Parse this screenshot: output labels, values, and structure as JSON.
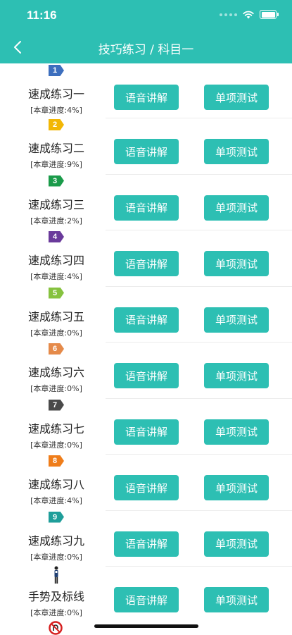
{
  "status_bar": {
    "time": "11:16"
  },
  "nav": {
    "title": "技巧练习 / 科目一",
    "back_icon": "chevron-left-icon"
  },
  "colors": {
    "accent": "#2dbfb3"
  },
  "buttons": {
    "voice": "语音讲解",
    "test": "单项测试"
  },
  "rows": [
    {
      "badge": "1",
      "badge_color": "#3d6fbe",
      "title": "速成练习一",
      "progress": "[本章进度:4%]"
    },
    {
      "badge": "2",
      "badge_color": "#f2b705",
      "title": "速成练习二",
      "progress": "[本章进度:9%]"
    },
    {
      "badge": "3",
      "badge_color": "#1a9b4a",
      "title": "速成练习三",
      "progress": "[本章进度:2%]"
    },
    {
      "badge": "4",
      "badge_color": "#6a3a9b",
      "title": "速成练习四",
      "progress": "[本章进度:4%]"
    },
    {
      "badge": "5",
      "badge_color": "#86c23f",
      "title": "速成练习五",
      "progress": "[本章进度:0%]"
    },
    {
      "badge": "6",
      "badge_color": "#e58a4a",
      "title": "速成练习六",
      "progress": "[本章进度:0%]"
    },
    {
      "badge": "7",
      "badge_color": "#4a4a4a",
      "title": "速成练习七",
      "progress": "[本章进度:0%]"
    },
    {
      "badge": "8",
      "badge_color": "#ef7d1a",
      "title": "速成练习八",
      "progress": "[本章进度:4%]"
    },
    {
      "badge": "9",
      "badge_color": "#1f9e9a",
      "title": "速成练习九",
      "progress": "[本章进度:0%]"
    },
    {
      "badge": "",
      "badge_color": "",
      "icon": "traffic-police-icon",
      "title": "手势及标线",
      "progress": "[本章进度:0%]"
    }
  ],
  "partial_row": {
    "icon": "no-u-turn-sign-icon"
  }
}
